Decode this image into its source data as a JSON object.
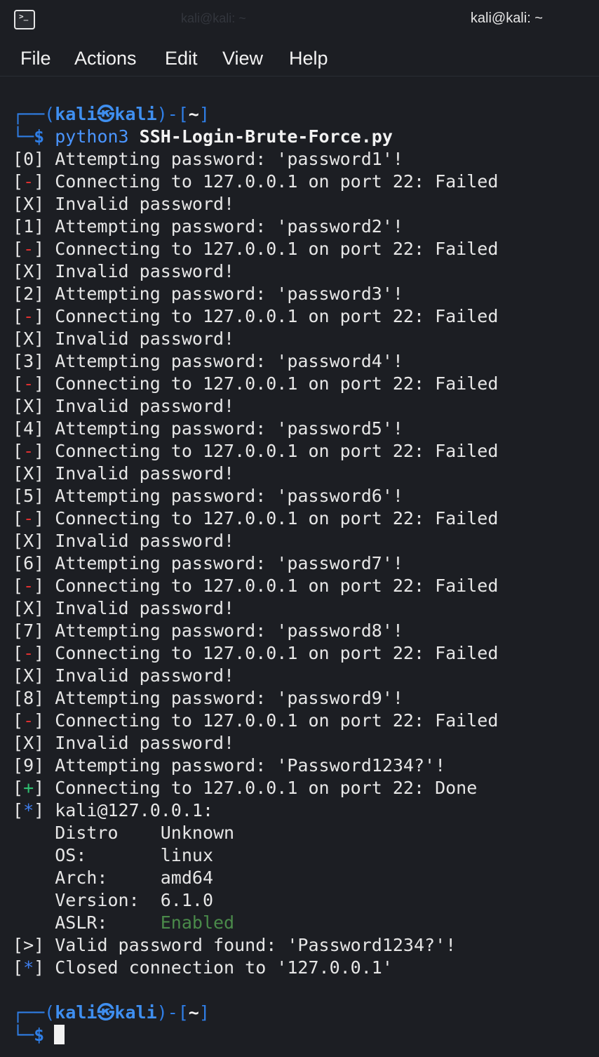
{
  "window": {
    "title": "kali@kali: ~",
    "ghost_title": "kali@kali: ~"
  },
  "menu": [
    "File",
    "Actions",
    "Edit",
    "View",
    "Help"
  ],
  "prompt": {
    "user": "kali",
    "host": "kali",
    "at_glyph": "㉿",
    "dir": "~",
    "dollar": "$"
  },
  "command": {
    "program": "python3",
    "script": "SSH-Login-Brute-Force.py"
  },
  "attempts": [
    {
      "index": "0",
      "password": "password1",
      "result": "Failed",
      "invalid": "Invalid password!"
    },
    {
      "index": "1",
      "password": "password2",
      "result": "Failed",
      "invalid": "Invalid password!"
    },
    {
      "index": "2",
      "password": "password3",
      "result": "Failed",
      "invalid": "Invalid password!"
    },
    {
      "index": "3",
      "password": "password4",
      "result": "Failed",
      "invalid": "Invalid password!"
    },
    {
      "index": "4",
      "password": "password5",
      "result": "Failed",
      "invalid": "Invalid password!"
    },
    {
      "index": "5",
      "password": "password6",
      "result": "Failed",
      "invalid": "Invalid password!"
    },
    {
      "index": "6",
      "password": "password7",
      "result": "Failed",
      "invalid": "Invalid password!"
    },
    {
      "index": "7",
      "password": "password8",
      "result": "Failed",
      "invalid": "Invalid password!"
    },
    {
      "index": "8",
      "password": "password9",
      "result": "Failed",
      "invalid": "Invalid password!"
    },
    {
      "index": "9",
      "password": "Password1234?",
      "result": "Done",
      "invalid": ""
    }
  ],
  "connect_text": "Connecting to 127.0.0.1 on port 22:",
  "attempt_text": "Attempting password:",
  "session": {
    "host": "kali@127.0.0.1:",
    "info": [
      {
        "key": "Distro",
        "value": "Unknown"
      },
      {
        "key": "OS:",
        "value": "linux"
      },
      {
        "key": "Arch:",
        "value": "amd64"
      },
      {
        "key": "Version:",
        "value": "6.1.0"
      },
      {
        "key": "ASLR:",
        "value": "Enabled"
      }
    ]
  },
  "valid_text": "Valid password found: 'Password1234?'!",
  "closed_text": "Closed connection to '127.0.0.1'",
  "colors": {
    "background": "#1c1e23",
    "prompt_blue": "#2f7ee6",
    "error_red": "#e03030",
    "success_green": "#2fbf71",
    "aslr_green": "#4a8a4a"
  }
}
